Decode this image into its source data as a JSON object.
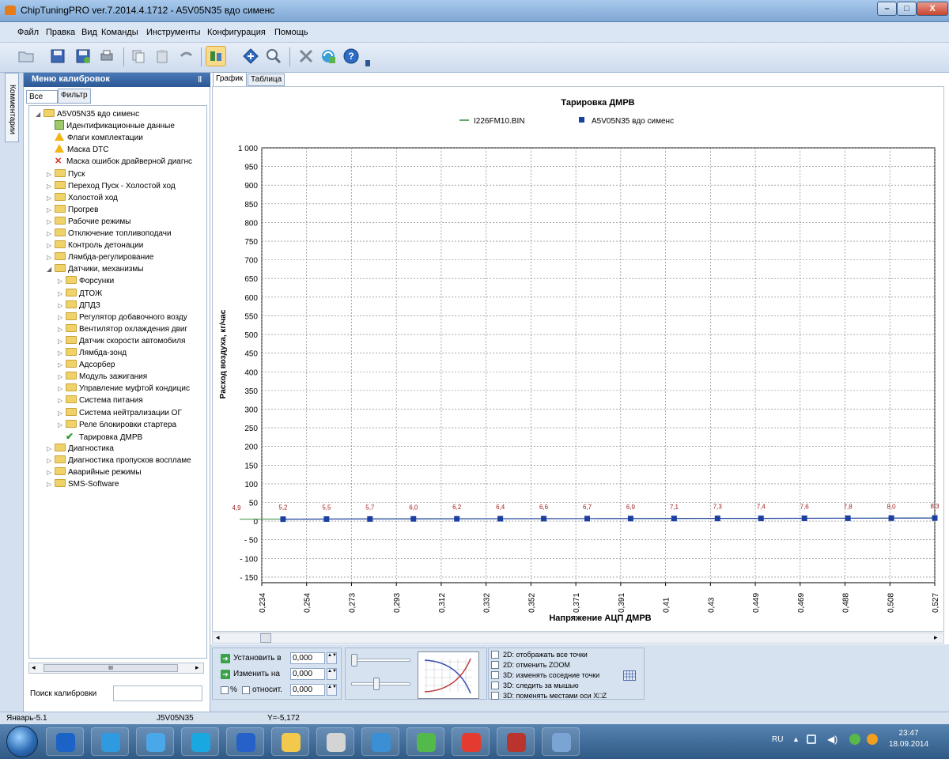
{
  "window": {
    "title": "ChipTuningPRO ver.7.2014.4.1712 - A5V05N35 вдо сименс",
    "buttons": {
      "minimize": "–",
      "maximize": "□",
      "close": "X"
    }
  },
  "menu": [
    "Файл",
    "Правка",
    "Вид",
    "Команды",
    "Инструменты",
    "Конфигурация",
    "Помощь"
  ],
  "toolbar_icons": [
    "open-icon",
    "save-icon",
    "save-as-icon",
    "print-icon",
    "copy-icon",
    "paste-icon",
    "undo-icon",
    "calibration-icon",
    "diamond-icon",
    "search-icon",
    "settings-icon",
    "update-icon",
    "help-icon"
  ],
  "side_tab": "Комментарии",
  "left_panel": {
    "title": "Меню калибровок",
    "pin": "Ⅱ",
    "tabs": [
      "Все",
      "Фильтр"
    ],
    "search_label": "Поиск калибровки",
    "search_value": "",
    "scroll_glyph": "III",
    "tree": [
      {
        "label": "A5V05N35 вдо сименс",
        "level": 0,
        "icon": "folder",
        "arrow": "open"
      },
      {
        "label": "Идентификационные данные",
        "level": 1,
        "icon": "doc",
        "arrow": ""
      },
      {
        "label": "Флаги комплектации",
        "level": 1,
        "icon": "warn",
        "arrow": ""
      },
      {
        "label": "Маска DTC",
        "level": 1,
        "icon": "warn",
        "arrow": ""
      },
      {
        "label": "Маска ошибок драйверной диагнс",
        "level": 1,
        "icon": "x",
        "arrow": ""
      },
      {
        "label": "Пуск",
        "level": 1,
        "icon": "folder",
        "arrow": "closed"
      },
      {
        "label": "Переход Пуск - Холостой ход",
        "level": 1,
        "icon": "folder",
        "arrow": "closed"
      },
      {
        "label": "Холостой ход",
        "level": 1,
        "icon": "folder",
        "arrow": "closed"
      },
      {
        "label": "Прогрев",
        "level": 1,
        "icon": "folder",
        "arrow": "closed"
      },
      {
        "label": "Рабочие режимы",
        "level": 1,
        "icon": "folder",
        "arrow": "closed"
      },
      {
        "label": "Отключение топливоподачи",
        "level": 1,
        "icon": "folder",
        "arrow": "closed"
      },
      {
        "label": "Контроль детонации",
        "level": 1,
        "icon": "folder",
        "arrow": "closed"
      },
      {
        "label": "Лямбда-регулирование",
        "level": 1,
        "icon": "folder",
        "arrow": "closed"
      },
      {
        "label": "Датчики, механизмы",
        "level": 1,
        "icon": "folder",
        "arrow": "open"
      },
      {
        "label": "Форсунки",
        "level": 2,
        "icon": "folder",
        "arrow": "closed"
      },
      {
        "label": "ДТОЖ",
        "level": 2,
        "icon": "folder",
        "arrow": "closed"
      },
      {
        "label": "ДПДЗ",
        "level": 2,
        "icon": "folder",
        "arrow": "closed"
      },
      {
        "label": "Регулятор добавочного возду",
        "level": 2,
        "icon": "folder",
        "arrow": "closed"
      },
      {
        "label": "Вентилятор охлаждения двиг",
        "level": 2,
        "icon": "folder",
        "arrow": "closed"
      },
      {
        "label": "Датчик скорости автомобиля",
        "level": 2,
        "icon": "folder",
        "arrow": "closed"
      },
      {
        "label": "Лямбда-зонд",
        "level": 2,
        "icon": "folder",
        "arrow": "closed"
      },
      {
        "label": "Адсорбер",
        "level": 2,
        "icon": "folder",
        "arrow": "closed"
      },
      {
        "label": "Модуль зажигания",
        "level": 2,
        "icon": "folder",
        "arrow": "closed"
      },
      {
        "label": "Управление муфтой кондицис",
        "level": 2,
        "icon": "folder",
        "arrow": "closed"
      },
      {
        "label": "Система питания",
        "level": 2,
        "icon": "folder",
        "arrow": "closed"
      },
      {
        "label": "Система нейтрализации ОГ",
        "level": 2,
        "icon": "folder",
        "arrow": "closed"
      },
      {
        "label": "Реле блокировки стартера",
        "level": 2,
        "icon": "folder",
        "arrow": "closed"
      },
      {
        "label": "Тарировка ДМРВ",
        "level": 2,
        "icon": "check",
        "arrow": ""
      },
      {
        "label": "Диагностика",
        "level": 1,
        "icon": "folder",
        "arrow": "closed"
      },
      {
        "label": "Диагностика пропусков воспламе",
        "level": 1,
        "icon": "folder",
        "arrow": "closed"
      },
      {
        "label": "Аварийные режимы",
        "level": 1,
        "icon": "folder",
        "arrow": "closed"
      },
      {
        "label": "SMS-Software",
        "level": 1,
        "icon": "folder",
        "arrow": "closed"
      }
    ]
  },
  "view_tabs": [
    "График",
    "Таблица"
  ],
  "chart_data": {
    "type": "line",
    "title": "Тарировка ДМРВ",
    "xlabel": "Напряжение АЦП ДМРВ",
    "ylabel": "Расход воздуха, кг/час",
    "y_ticks": [
      "1 000",
      "950",
      "900",
      "850",
      "800",
      "750",
      "700",
      "650",
      "600",
      "550",
      "500",
      "450",
      "400",
      "350",
      "300",
      "250",
      "200",
      "150",
      "100",
      "50",
      "0",
      "- 50",
      "- 100",
      "- 150"
    ],
    "ylim": [
      -165,
      1000
    ],
    "x_tick_labels": [
      "0,234",
      "0,254",
      "0,273",
      "0,293",
      "0,312",
      "0,332",
      "0,352",
      "0,371",
      "0,391",
      "0,41",
      "0,43",
      "0,449",
      "0,469",
      "0,488",
      "0,508",
      "0,527"
    ],
    "point_labels": [
      "4,9",
      "5,2",
      "5,5",
      "5,7",
      "6,0",
      "6,2",
      "6,4",
      "6,6",
      "6,7",
      "6,9",
      "7,1",
      "7,3",
      "7,4",
      "7,6",
      "7,8",
      "8,0",
      "8,3"
    ],
    "legend_position": "top",
    "grid": true,
    "series": [
      {
        "name": "I226FM10.BIN",
        "color": "#2e8b3a",
        "values": [
          4.9,
          5.2,
          5.5,
          5.7,
          6.0,
          6.2,
          6.4,
          6.6,
          6.7,
          6.9,
          7.1,
          7.3,
          7.4,
          7.6,
          7.8,
          8.0,
          8.3
        ]
      },
      {
        "name": "A5V05N35 вдо сименс",
        "color": "#1c3fa0",
        "values": [
          4.9,
          5.2,
          5.5,
          5.7,
          6.0,
          6.2,
          6.4,
          6.6,
          6.7,
          6.9,
          7.1,
          7.3,
          7.4,
          7.6,
          7.8,
          8.0,
          8.3
        ]
      }
    ]
  },
  "controls": {
    "set_label": "Установить в",
    "set_value": "0,000",
    "change_label": "Изменить на",
    "change_value": "0,000",
    "percent_label": "%",
    "relative_label": "относит.",
    "relative_value": "0,000",
    "arrow_glyph": "➔",
    "spin_glyph": "▲▼",
    "options": [
      "2D: отображать все точки",
      "2D: отменить ZOOM",
      "3D: изменять соседние точки",
      "3D: следить за мышью",
      "3D: поменять местами оси X□Z"
    ]
  },
  "status": {
    "left": "Январь-5.1",
    "middle": "J5V05N35",
    "coords": "Y=-5,172"
  },
  "taskbar": {
    "lang": "RU",
    "time": "23:47",
    "date": "18.09.2014",
    "apps": [
      "media-icon",
      "ie-icon",
      "browser-icon",
      "skype-icon",
      "player-icon",
      "explorer-icon",
      "calendar-icon",
      "network-icon",
      "at-icon",
      "yandex-icon",
      "winrar-icon",
      "chiptuning-icon"
    ],
    "tray_icons": [
      "network-tray-icon",
      "volume-icon",
      "shield-tray-icon",
      "update-tray-icon"
    ]
  }
}
